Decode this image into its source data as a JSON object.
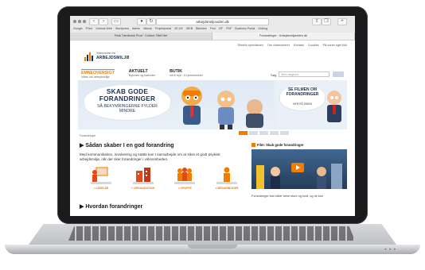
{
  "browser": {
    "address": "arbejdsmiljoviden.dk",
    "bookmarks": [
      "Google",
      "P.Net",
      "Outlook Web",
      "Wordpress",
      "Admin",
      "Mbook",
      "Projektportal",
      "ZE-DK",
      "WEB",
      "Bibliotek",
      "Find",
      "ZIF",
      "PDF",
      "Business Portal",
      "Ordbog"
    ],
    "tabs": [
      "Frisk Tænkersk Prod · Culture Tillet Net",
      "Forandringer · Arbejdsmiljøviden.dk"
    ]
  },
  "page": {
    "toplinks": [
      "Tilmeld nyhedsbrev",
      "Om videncentret",
      "Kontakt",
      "Cookies",
      "På vores eget folk"
    ],
    "logo": {
      "line1": "Videncenter for",
      "line2": "ARBEJDSMILJØ"
    },
    "nav": [
      {
        "label": "EMNEOVERSIGT",
        "sub": "Viden om arbejdsmiljø"
      },
      {
        "label": "AKTUELT",
        "sub": "Nyheder og kalender"
      },
      {
        "label": "BUTIK",
        "sub": "Alt til tryk - & hjemmesider"
      }
    ],
    "search": {
      "label": "Søg",
      "placeholder": "Skriv søgeord"
    },
    "banner": {
      "headline": "SKAB GODE FORANDRINGER",
      "subline": "SÅ BEKYMRINGERNE FYLDER MINDRE",
      "promo_headline": "SE FILMEN OM FORANDRINGER",
      "promo_sub": "HER PÅ SIDEN"
    },
    "breadcrumb": "Forandringer",
    "heading": "Sådan skaber I en god forandring",
    "intro": "Med kommunikation, involvering og støtte kan I samarbejde om at sikre et godt psykisk arbejdsmiljø, når der sker forandringer i virksomheden.",
    "levels": [
      {
        "label": "» LEDELSE"
      },
      {
        "label": "» ORGANISATION"
      },
      {
        "label": "» GRUPPE"
      },
      {
        "label": "» MEDARBEJDER"
      }
    ],
    "heading2": "Hvordan forandringer",
    "video": {
      "title": "Film: Skab gode forandringer"
    },
    "caption": "Forandringer kan både være store og små, og de kan"
  },
  "colors": {
    "accent": "#ef7d00",
    "navy": "#0c2f66",
    "banner_bg": "#e9eef6"
  }
}
